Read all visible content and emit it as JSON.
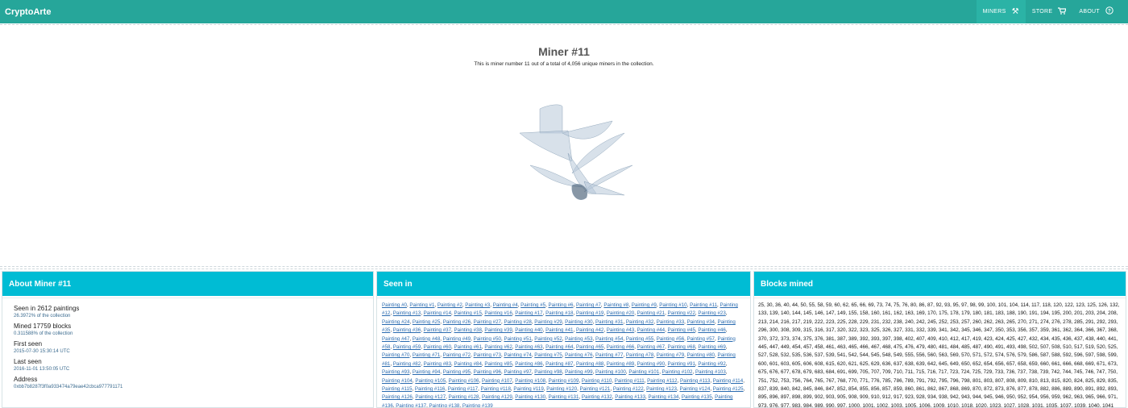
{
  "app": {
    "brand": "CryptoArte"
  },
  "nav": {
    "items": [
      {
        "label": "MINERS",
        "icon": "pickaxe-icon",
        "glyph": "⚒",
        "active": true
      },
      {
        "label": "STORE",
        "icon": "cart-icon",
        "glyph": "🛒",
        "active": false
      },
      {
        "label": "ABOUT",
        "icon": "help-icon",
        "glyph": "?",
        "active": false
      }
    ]
  },
  "hero": {
    "title": "Miner #11",
    "subtitle": "This is miner number 11 out of a total of 4,056 unique miners in the collection."
  },
  "about": {
    "title": "About Miner #11",
    "seen_in": "Seen in 2612 paintings",
    "seen_pct": "26.3972% of the collection",
    "mined": "Mined 17759 blocks",
    "mined_pct": "0.311588% of the collection",
    "first_seen_label": "First seen",
    "first_seen": "2015-07-30 15:30:14 UTC",
    "last_seen_label": "Last seen",
    "last_seen": "2016-11-01 13:50:05 UTC",
    "address_label": "Address",
    "address": "0xbb7b8287f3f0a933474a79eae42cbca977791171"
  },
  "seen": {
    "title": "Seen in",
    "paintings": [
      0,
      1,
      2,
      3,
      4,
      5,
      6,
      7,
      8,
      9,
      10,
      11,
      12,
      13,
      14,
      15,
      16,
      17,
      18,
      19,
      20,
      21,
      22,
      23,
      24,
      25,
      26,
      27,
      28,
      29,
      30,
      31,
      32,
      33,
      34,
      35,
      36,
      37,
      38,
      39,
      40,
      41,
      42,
      43,
      44,
      45,
      46,
      47,
      48,
      49,
      50,
      51,
      52,
      53,
      54,
      55,
      56,
      57,
      58,
      59,
      60,
      61,
      62,
      63,
      64,
      65,
      66,
      67,
      68,
      69,
      70,
      71,
      72,
      73,
      74,
      75,
      76,
      77,
      78,
      79,
      80,
      81,
      82,
      83,
      84,
      85,
      86,
      87,
      88,
      89,
      90,
      91,
      92,
      93,
      94,
      95,
      96,
      97,
      98,
      99,
      100,
      101,
      102,
      103,
      104,
      105,
      106,
      107,
      108,
      109,
      110,
      111,
      112,
      113,
      114,
      115,
      116,
      117,
      118,
      119,
      120,
      121,
      122,
      123,
      124,
      125,
      126,
      127,
      128,
      129,
      130,
      131,
      132,
      133,
      134,
      135,
      136,
      137,
      138,
      139
    ],
    "prefix": "Painting #"
  },
  "blocks": {
    "title": "Blocks mined",
    "text": "25, 30, 36, 40, 44, 50, 55, 58, 59, 60, 62, 65, 66, 69, 73, 74, 75, 76, 80, 86, 87, 92, 93, 95, 97, 98, 99, 100, 101, 104, 114, 117, 118, 120, 122, 123, 125, 126, 132, 133, 139, 140, 144, 145, 146, 147, 149, 155, 158, 160, 161, 162, 163, 169, 170, 175, 178, 179, 180, 181, 183, 188, 190, 191, 194, 195, 200, 201, 203, 204, 208, 213, 214, 216, 217, 219, 222, 223, 225, 228, 229, 231, 232, 238, 240, 242, 245, 252, 253, 257, 260, 262, 263, 265, 270, 271, 274, 276, 278, 285, 291, 292, 293, 296, 300, 308, 309, 315, 316, 317, 320, 322, 323, 325, 326, 327, 331, 332, 339, 341, 342, 345, 346, 347, 350, 353, 356, 357, 359, 361, 362, 364, 366, 367, 368, 370, 372, 373, 374, 375, 376, 381, 387, 389, 392, 393, 397, 398, 402, 407, 409, 410, 412, 417, 419, 423, 424, 425, 427, 432, 434, 435, 436, 437, 438, 440, 441, 445, 447, 449, 454, 457, 458, 461, 463, 465, 466, 467, 468, 475, 476, 479, 480, 481, 484, 485, 487, 490, 491, 493, 498, 502, 507, 508, 510, 517, 519, 520, 525, 527, 528, 532, 535, 536, 537, 539, 541, 542, 544, 545, 548, 549, 555, 556, 560, 563, 569, 570, 571, 572, 574, 576, 579, 586, 587, 588, 592, 596, 597, 598, 599, 600, 601, 603, 605, 606, 608, 615, 620, 621, 625, 629, 636, 637, 638, 639, 642, 645, 649, 650, 652, 654, 656, 657, 658, 659, 660, 661, 666, 668, 669, 671, 673, 675, 676, 677, 678, 679, 683, 684, 691, 699, 705, 707, 709, 710, 711, 715, 716, 717, 723, 724, 725, 729, 733, 736, 737, 738, 739, 742, 744, 745, 746, 747, 750, 751, 752, 753, 756, 764, 765, 767, 768, 770, 771, 776, 785, 786, 789, 791, 792, 795, 796, 798, 801, 803, 807, 808, 809, 810, 813, 815, 820, 824, 825, 829, 835, 837, 839, 840, 842, 845, 846, 847, 852, 854, 855, 856, 857, 859, 860, 861, 862, 867, 868, 869, 870, 872, 873, 876, 877, 878, 882, 886, 889, 890, 891, 892, 893, 895, 896, 897, 898, 899, 902, 903, 905, 908, 909, 910, 912, 917, 923, 928, 934, 938, 942, 943, 944, 945, 946, 950, 952, 954, 956, 959, 962, 963, 965, 966, 971, 973, 976, 977, 983, 984, 989, 990, 997, 1000, 1001, 1002, 1003, 1005, 1006, 1009, 1010, 1018, 1020, 1023, 1027, 1028, 1031, 1035, 1037, 1039, 1040, 1041"
  },
  "colors": {
    "topbar": "#26a69a",
    "card_header": "#00bcd4",
    "link": "#2a6bb0"
  }
}
